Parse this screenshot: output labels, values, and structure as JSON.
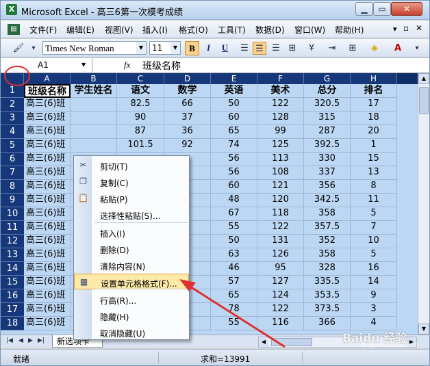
{
  "window": {
    "title": "Microsoft Excel - 高三6第一次模考成绩"
  },
  "menu": {
    "items": [
      "文件(F)",
      "编辑(E)",
      "视图(V)",
      "插入(I)",
      "格式(O)",
      "工具(T)",
      "数据(D)",
      "窗口(W)",
      "帮助(H)"
    ]
  },
  "toolbar": {
    "font": "Times New Roman",
    "size": "11",
    "bold": "B",
    "italic": "I",
    "underline": "U"
  },
  "formula_bar": {
    "cell_ref": "A1",
    "fx": "fx",
    "content": "班级名称"
  },
  "sheet": {
    "columns": [
      "A",
      "B",
      "C",
      "D",
      "E",
      "F",
      "G",
      "H"
    ],
    "headers": [
      "班级名称",
      "学生姓名",
      "语文",
      "数学",
      "英语",
      "美术",
      "总分",
      "排名"
    ],
    "row_numbers": [
      "1",
      "2",
      "3",
      "4",
      "5",
      "6",
      "7",
      "8",
      "9",
      "10",
      "11",
      "12",
      "13",
      "14",
      "15",
      "16",
      "17",
      "18"
    ],
    "rows": [
      [
        "高三(6)班",
        "",
        "82.5",
        "66",
        "50",
        "122",
        "320.5",
        "17"
      ],
      [
        "高三(6)班",
        "",
        "90",
        "37",
        "60",
        "128",
        "315",
        "18"
      ],
      [
        "高三(6)班",
        "",
        "87",
        "36",
        "65",
        "99",
        "287",
        "20"
      ],
      [
        "高三(6)班",
        "",
        "101.5",
        "92",
        "74",
        "125",
        "392.5",
        "1"
      ],
      [
        "高三(6)班",
        "",
        "",
        "",
        "56",
        "113",
        "330",
        "15"
      ],
      [
        "高三(6)班",
        "",
        "",
        "",
        "56",
        "108",
        "337",
        "13"
      ],
      [
        "高三(6)班",
        "",
        "",
        "",
        "60",
        "121",
        "356",
        "8"
      ],
      [
        "高三(6)班",
        "",
        "",
        "",
        "48",
        "120",
        "342.5",
        "11"
      ],
      [
        "高三(6)班",
        "",
        "",
        "",
        "67",
        "118",
        "358",
        "5"
      ],
      [
        "高三(6)班",
        "",
        "",
        "",
        "55",
        "122",
        "357.5",
        "7"
      ],
      [
        "高三(6)班",
        "",
        "",
        "",
        "50",
        "131",
        "352",
        "10"
      ],
      [
        "高三(6)班",
        "",
        "",
        "",
        "63",
        "126",
        "358",
        "5"
      ],
      [
        "高三(6)班",
        "",
        "",
        "",
        "46",
        "95",
        "328",
        "16"
      ],
      [
        "高三(6)班",
        "",
        "",
        "",
        "57",
        "127",
        "335.5",
        "14"
      ],
      [
        "高三(6)班",
        "",
        "",
        "",
        "65",
        "124",
        "353.5",
        "9"
      ],
      [
        "高三(6)班",
        "",
        "",
        "",
        "78",
        "122",
        "373.5",
        "3"
      ],
      [
        "高三(6)班",
        "",
        "",
        "",
        "55",
        "116",
        "366",
        "4"
      ]
    ]
  },
  "context_menu": {
    "items": [
      {
        "label": "剪切(T)",
        "icon": "scissors-icon",
        "glyph": "✂"
      },
      {
        "label": "复制(C)",
        "icon": "copy-icon",
        "glyph": "❐"
      },
      {
        "label": "粘贴(P)",
        "icon": "paste-icon",
        "glyph": "📋"
      },
      {
        "label": "选择性粘贴(S)...",
        "icon": "",
        "glyph": ""
      },
      {
        "label": "插入(I)",
        "icon": "",
        "glyph": ""
      },
      {
        "label": "删除(D)",
        "icon": "",
        "glyph": ""
      },
      {
        "label": "清除内容(N)",
        "icon": "",
        "glyph": ""
      },
      {
        "label": "设置单元格格式(F)...",
        "icon": "format-cells-icon",
        "glyph": "▦"
      },
      {
        "label": "行高(R)...",
        "icon": "",
        "glyph": ""
      },
      {
        "label": "隐藏(H)",
        "icon": "",
        "glyph": ""
      },
      {
        "label": "取消隐藏(U)",
        "icon": "",
        "glyph": ""
      }
    ],
    "highlighted": "设置单元格格式(F)..."
  },
  "tabs": {
    "sheet_tab": "新选项卡"
  },
  "status": {
    "ready": "就绪",
    "sum": "求和=13991"
  },
  "watermark": {
    "text": "Baidu 经验",
    "sub": "jingyan.baidu.com"
  },
  "colors": {
    "header_bg": "#16387a",
    "selection_bg": "#bcd7f4",
    "highlight": "#fde9a8",
    "annotation": "#e03030"
  }
}
